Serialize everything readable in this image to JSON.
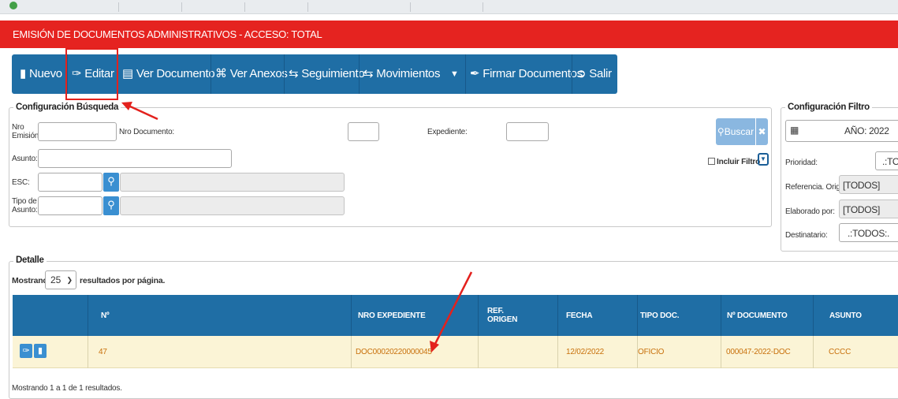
{
  "window": {
    "title": "EMISIÓN DE DOCUMENTOS ADMINISTRATIVOS - ACCESO: TOTAL"
  },
  "toolbar": {
    "nuevo": "Nuevo",
    "editar": "Editar",
    "ver_documento": "Ver Documento",
    "ver_anexos": "Ver Anexos",
    "seguimiento": "Seguimiento",
    "movimientos": "Movimientos",
    "firmar_documentos": "Firmar Documentos",
    "salir": "Salir"
  },
  "search_config": {
    "legend": "Configuración Búsqueda",
    "nro_emision_label": "Nro Emisión:",
    "nro_documento_label": "Nro Documento:",
    "expediente_label": "Expediente:",
    "asunto_label": "Asunto:",
    "esc_label": "ESC:",
    "tipo_asunto_label": "Tipo de Asunto:",
    "buscar_button": "Buscar",
    "incluir_filtro_label": "Incluir Filtro"
  },
  "filter_config": {
    "legend": "Configuración Filtro",
    "year_value": "AÑO: 2022",
    "prioridad_label": "Prioridad:",
    "prioridad_value": ".:TOD",
    "referencia_origen_label": "Referencia. Origen:",
    "referencia_origen_value": "[TODOS]",
    "elaborado_por_label": "Elaborado por:",
    "elaborado_por_value": "[TODOS]",
    "destinatario_label": "Destinatario:",
    "destinatario_value": ".:TODOS:."
  },
  "detail": {
    "legend": "Detalle",
    "showing_prefix": "Mostrando",
    "page_size": "25",
    "showing_suffix": "resultados por página.",
    "columns": {
      "nro": "Nº",
      "nro_expediente": "NRO EXPEDIENTE",
      "ref_origen_1": "REF.",
      "ref_origen_2": "ORIGEN",
      "fecha": "FECHA",
      "tipo_doc": "TIPO DOC.",
      "nro_documento": "Nº DOCUMENTO",
      "asunto": "ASUNTO"
    },
    "rows": [
      {
        "nro": "47",
        "nro_expediente": "DOC00020220000045",
        "ref_origen": "",
        "fecha": "12/02/2022",
        "tipo_doc": "OFICIO",
        "nro_documento": "000047-2022-DOC",
        "asunto": "CCCC"
      }
    ],
    "footer": "Mostrando 1 a 1 de 1 resultados."
  },
  "colors": {
    "title_bar": "#e52320",
    "toolbar": "#1f6ea5",
    "table_header": "#1f6ea5",
    "row_background": "#fbf4d6",
    "row_text": "#c8700b",
    "annotation": "#e3211d"
  },
  "icons": {
    "nuevo": "document-icon",
    "editar": "edit-icon",
    "ver_documento": "list-document-icon",
    "ver_anexos": "paperclip-icon",
    "seguimiento": "transfer-icon",
    "movimientos": "transfer-icon",
    "firmar_documentos": "pen-icon",
    "salir": "exit-icon"
  }
}
